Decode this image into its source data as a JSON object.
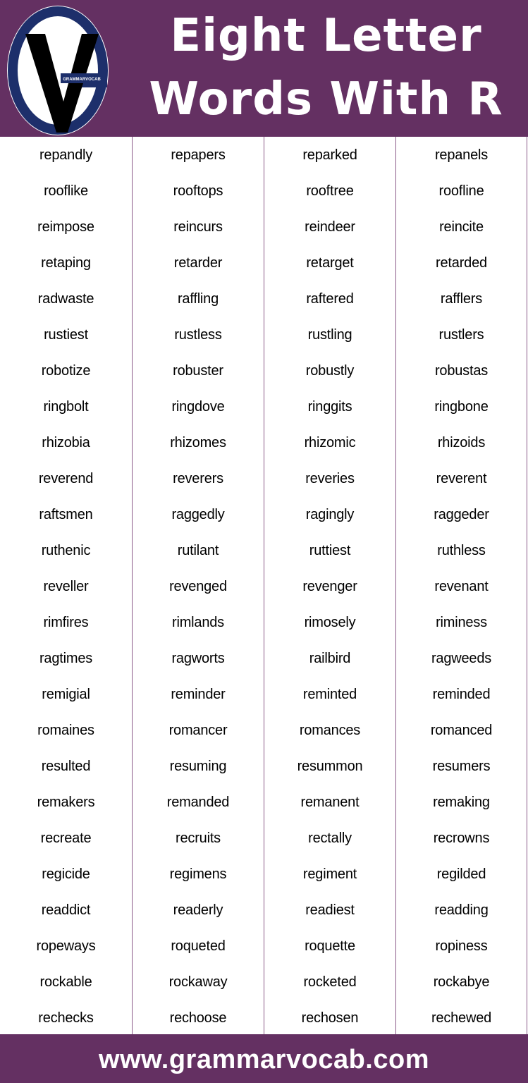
{
  "header": {
    "title_line1": "Eight Letter",
    "title_line2": "Words With R",
    "logo_text": "GRAMMARVOCAB",
    "background_color": "#643062"
  },
  "word_grid": {
    "columns": [
      {
        "words": [
          "repandly",
          "rooflike",
          "reimpose",
          "retaping",
          "radwaste",
          "rustiest",
          "robotize",
          "ringbolt",
          "rhizobia",
          "reverend",
          "raftsmen",
          "ruthenic",
          "reveller",
          "rimfires",
          "ragtimes",
          "remigial",
          "romaines",
          "resulted",
          "remakers",
          "recreate",
          "regicide",
          "readdict",
          "ropeways",
          "rockable",
          "rechecks"
        ]
      },
      {
        "words": [
          "repapers",
          "rooftops",
          "reincurs",
          "retarder",
          "raffling",
          "rustless",
          "robuster",
          "ringdove",
          "rhizomes",
          "reverers",
          "raggedly",
          "rutilant",
          "revenged",
          "rimlands",
          "ragworts",
          "reminder",
          "romancer",
          "resuming",
          "remanded",
          "recruits",
          "regimens",
          "readerly",
          "roqueted",
          "rockaway",
          "rechoose"
        ]
      },
      {
        "words": [
          "reparked",
          "rooftree",
          "reindeer",
          "retarget",
          "raftered",
          "rustling",
          "robustly",
          "ringgits",
          "rhizomic",
          "reveries",
          "ragingly",
          "ruttiest",
          "revenger",
          "rimosely",
          "railbird",
          "reminted",
          "romances",
          "resummon",
          "remanent",
          "rectally",
          "regiment",
          "readiest",
          "roquette",
          "rocketed",
          "rechosen"
        ]
      },
      {
        "words": [
          "repanels",
          "roofline",
          "reincite",
          "retarded",
          "rafflers",
          "rustlers",
          "robustas",
          "ringbone",
          "rhizoids",
          "reverent",
          "raggeder",
          "ruthless",
          "revenant",
          "riminess",
          "ragweeds",
          "reminded",
          "romanced",
          "resumers",
          "remaking",
          "recrowns",
          "regilded",
          "readding",
          "ropiness",
          "rockabye",
          "rechewed"
        ]
      }
    ]
  },
  "footer": {
    "url": "www.grammarvocab.com"
  }
}
